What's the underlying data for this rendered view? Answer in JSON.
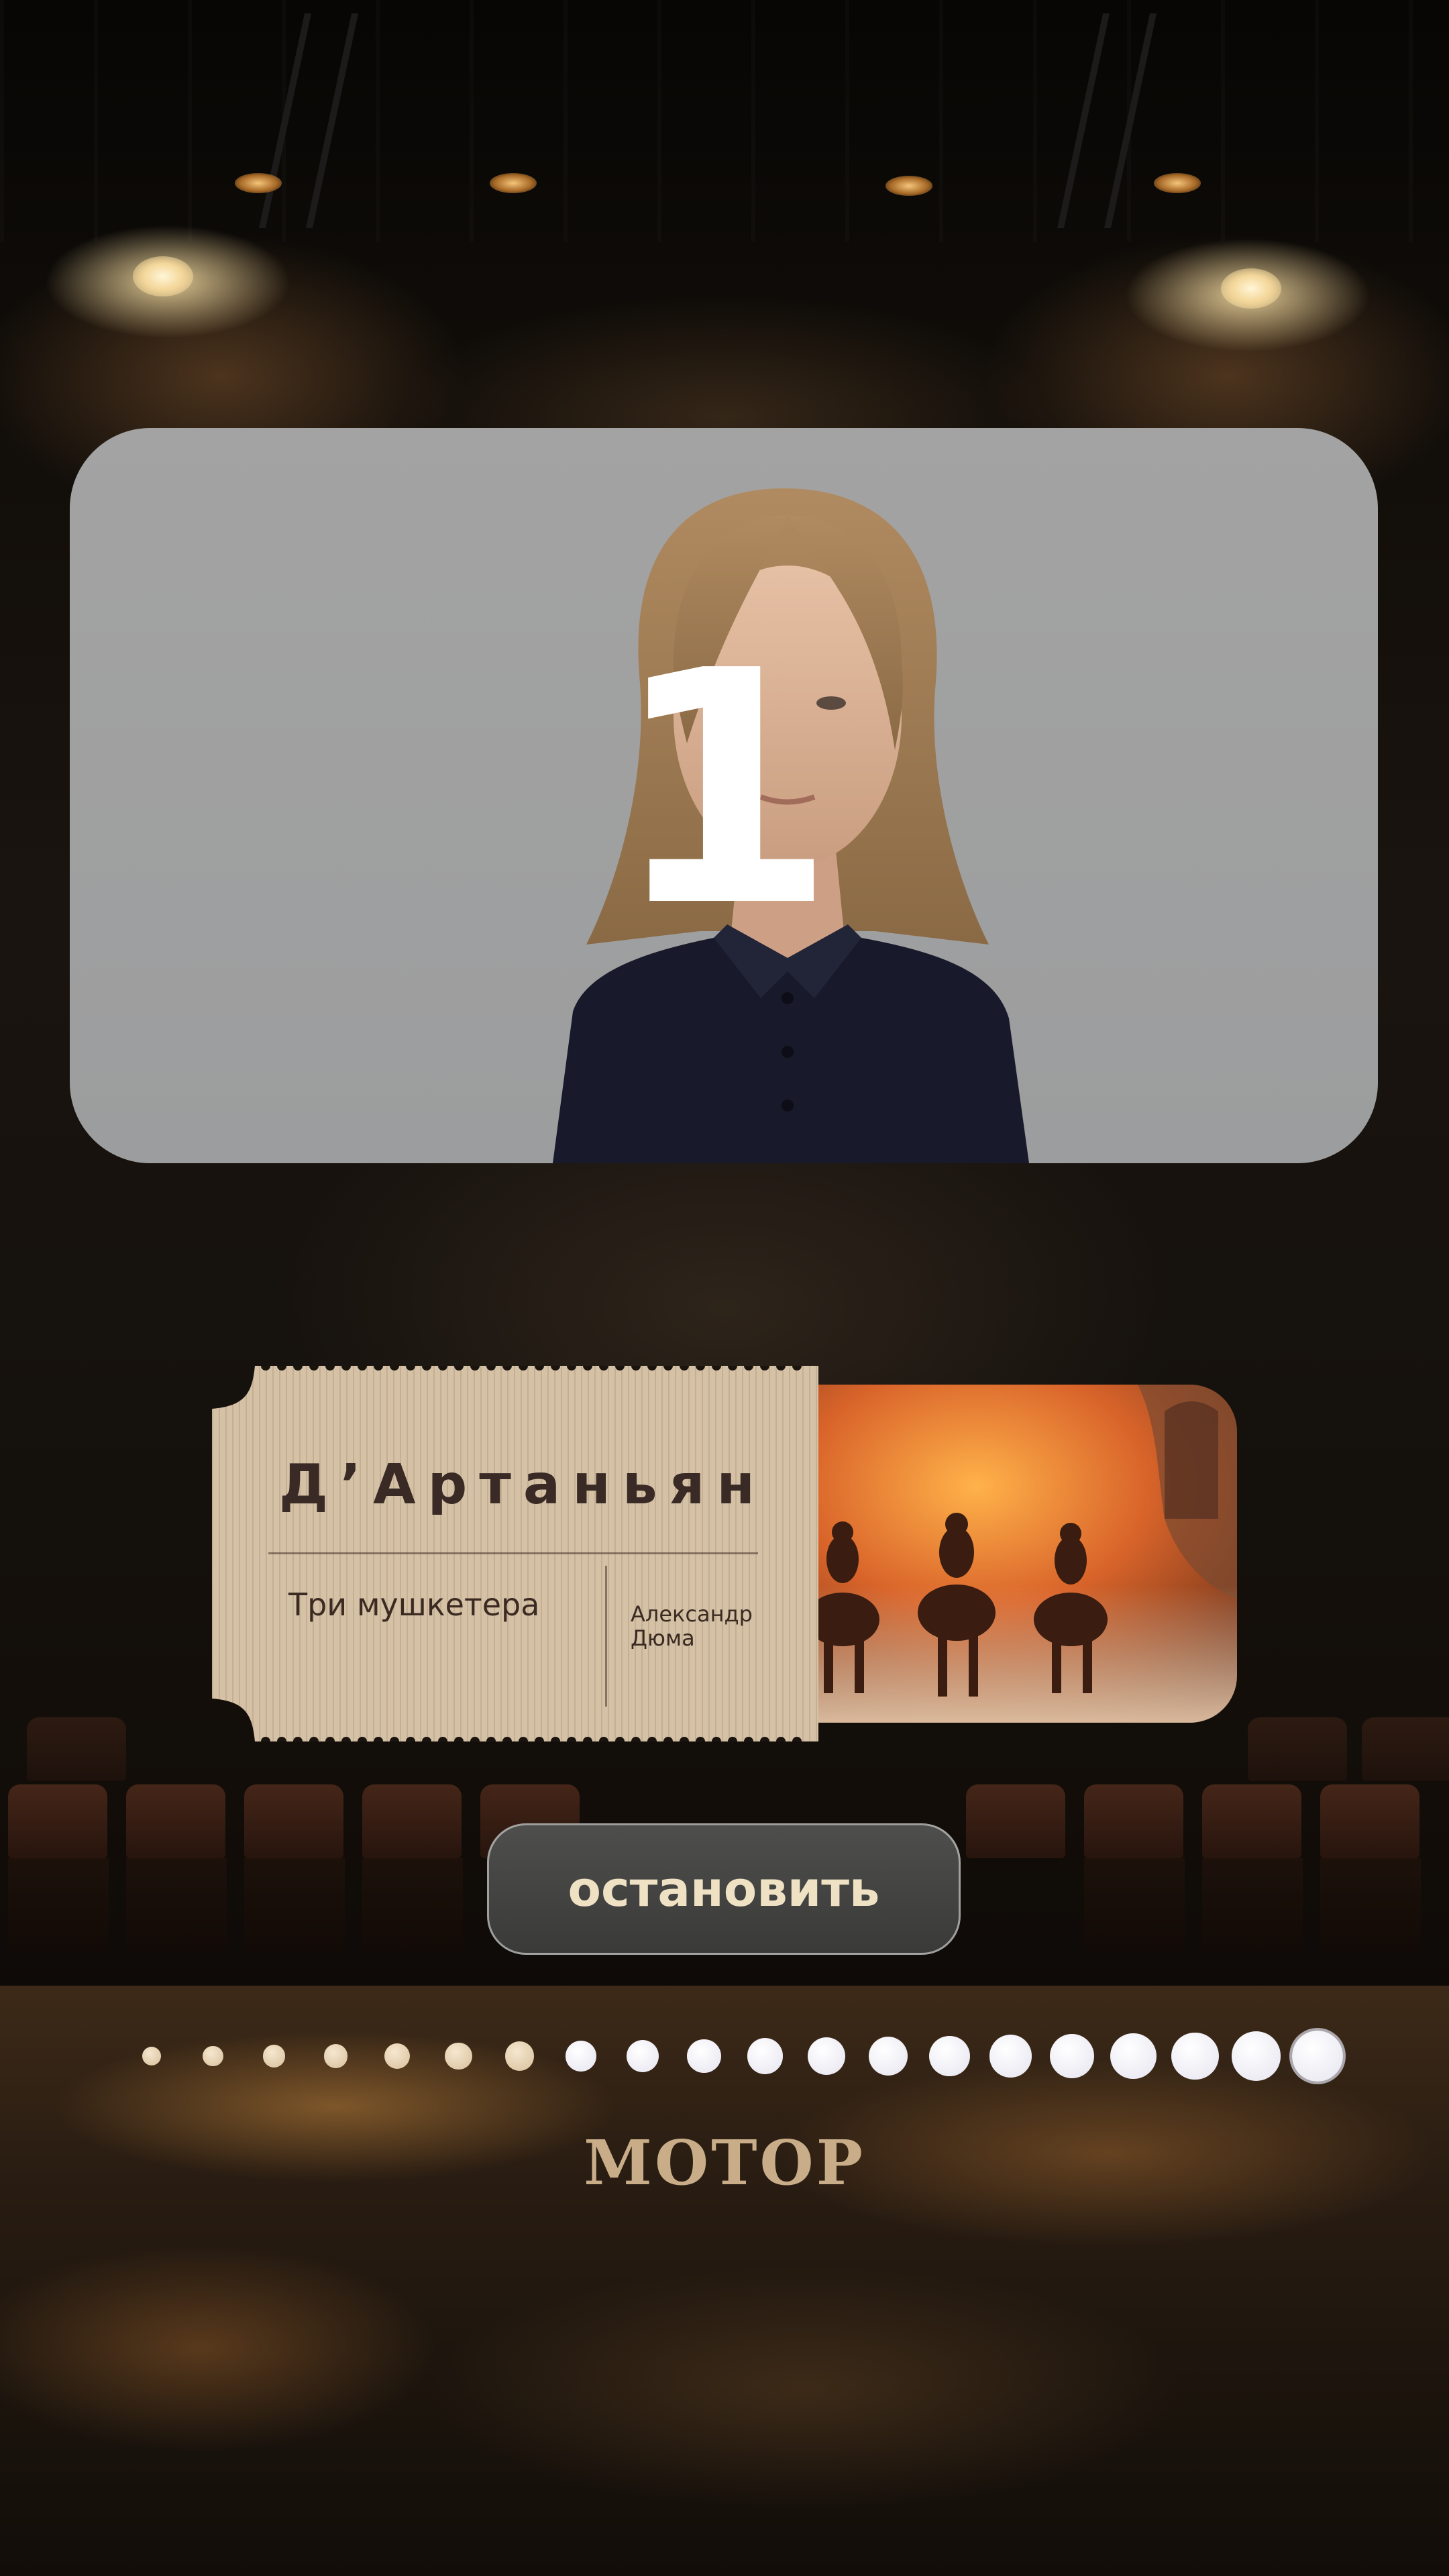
{
  "screen": {
    "countdown": "1",
    "role": "Д’Артаньян",
    "play_title": "Три мушкетера",
    "author": "Александр Дюма",
    "stop_button": "остановить",
    "brand": "МОТОР"
  },
  "progress": {
    "total_dots": 20,
    "current_step": 20
  },
  "icons": {
    "video": "actress-portrait",
    "poster": "burning-horsemen-scene"
  },
  "colors": {
    "accent_text": "#efe2c4",
    "brand": "#c8ad88",
    "ticket_paper": "#d7c3a8",
    "ink": "#3a2a26"
  }
}
